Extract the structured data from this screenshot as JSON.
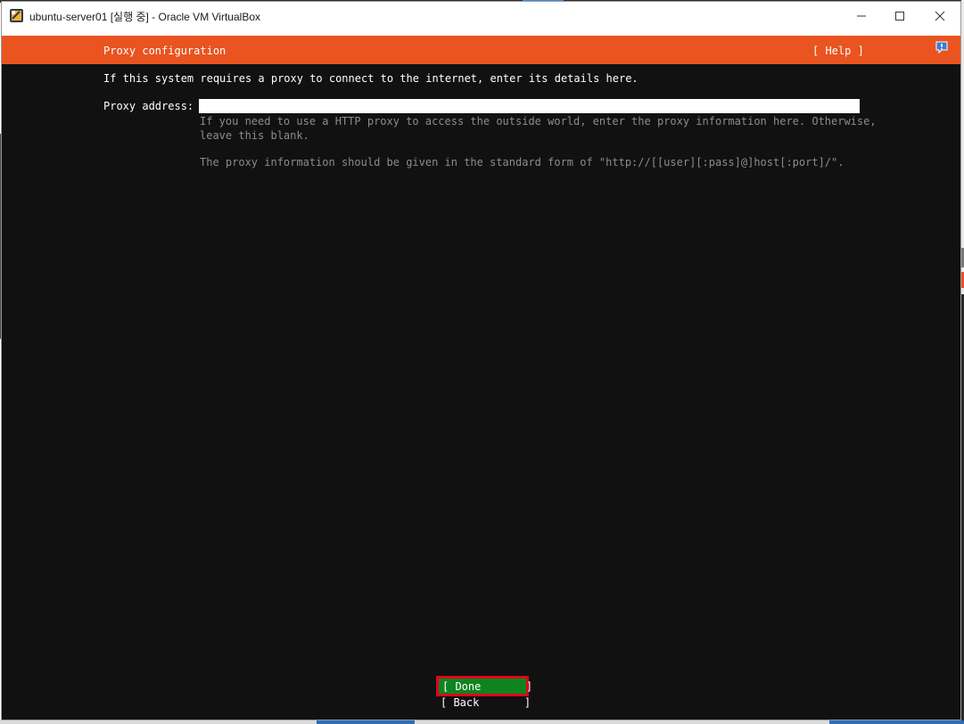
{
  "window": {
    "title": "ubuntu-server01 [실행 중] - Oracle VM VirtualBox"
  },
  "header": {
    "title": "Proxy configuration",
    "help_label": "[ Help ]"
  },
  "content": {
    "intro": "If this system requires a proxy to connect to the internet, enter its details here.",
    "proxy_label": "Proxy address:",
    "proxy_value": "",
    "help_line1": "If you need to use a HTTP proxy to access the outside world, enter the proxy information here. Otherwise,\nleave this blank.",
    "help_line2": "The proxy information should be given in the standard form of \"http://[[user][:pass]@]host[:port]/\"."
  },
  "buttons": {
    "done": "[ Done       ]",
    "back": "[ Back       ]"
  },
  "colors": {
    "header": "#e95420",
    "done_bg": "#0e8420",
    "highlight": "#e0001b",
    "screen_bg": "#111111"
  }
}
